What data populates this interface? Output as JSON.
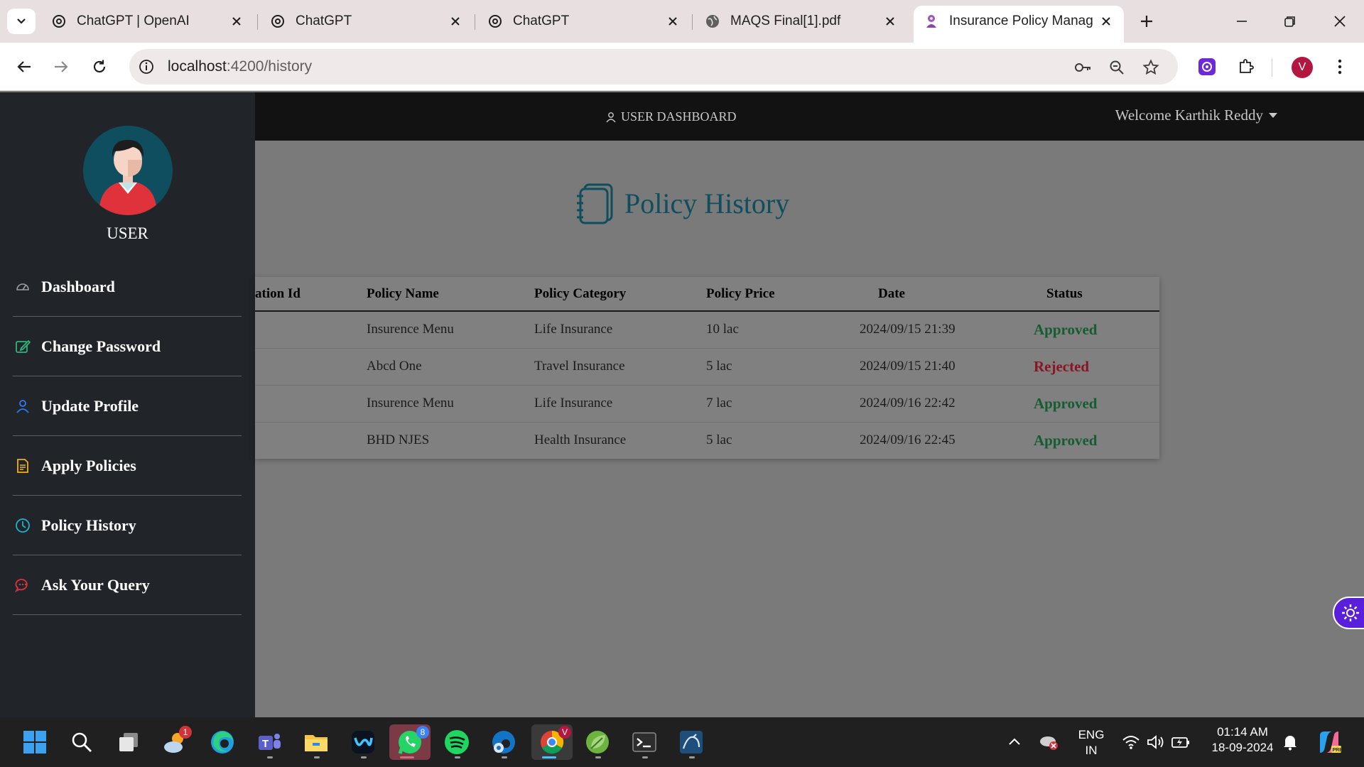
{
  "browser": {
    "tabs": [
      {
        "title": "ChatGPT | OpenAI",
        "icon": "openai-icon"
      },
      {
        "title": "ChatGPT",
        "icon": "openai-icon"
      },
      {
        "title": "ChatGPT",
        "icon": "openai-icon"
      },
      {
        "title": "MAQS Final[1].pdf",
        "icon": "globe-icon"
      },
      {
        "title": "Insurance Policy Managem",
        "icon": "app-icon",
        "active": true
      }
    ],
    "url_host": "localhost",
    "url_path": ":4200/history",
    "profile_initial": "V"
  },
  "topnav": {
    "dashboard_label": "USER DASHBOARD",
    "welcome": "Welcome Karthik Reddy"
  },
  "sidebar": {
    "role": "USER",
    "items": [
      {
        "label": "Dashboard",
        "icon": "speedometer-icon",
        "color": "#9aa0a6"
      },
      {
        "label": "Change Password",
        "icon": "edit-icon",
        "color": "#2eb67d"
      },
      {
        "label": "Update Profile",
        "icon": "person-icon",
        "color": "#2f7df6"
      },
      {
        "label": "Apply Policies",
        "icon": "document-icon",
        "color": "#f2b01e"
      },
      {
        "label": "Policy History",
        "icon": "clock-icon",
        "color": "#1fb3d2"
      },
      {
        "label": "Ask Your Query",
        "icon": "chat-icon",
        "color": "#d9343f"
      }
    ]
  },
  "page": {
    "title": "Policy History"
  },
  "table": {
    "headers": [
      "ation Id",
      "Policy Name",
      "Policy Category",
      "Policy Price",
      "Date",
      "Status"
    ],
    "rows": [
      {
        "id": "",
        "name": "Insurence Menu",
        "category": "Life Insurance",
        "price": "10 lac",
        "date": "2024/09/15 21:39",
        "status": "Approved"
      },
      {
        "id": "",
        "name": "Abcd One",
        "category": "Travel Insurance",
        "price": "5 lac",
        "date": "2024/09/15 21:40",
        "status": "Rejected"
      },
      {
        "id": "",
        "name": "Insurence Menu",
        "category": "Life Insurance",
        "price": "7 lac",
        "date": "2024/09/16 22:42",
        "status": "Approved"
      },
      {
        "id": "",
        "name": "BHD NJES",
        "category": "Health Insurance",
        "price": "5 lac",
        "date": "2024/09/16 22:45",
        "status": "Approved"
      }
    ]
  },
  "taskbar": {
    "apps": [
      {
        "name": "start-button"
      },
      {
        "name": "search"
      },
      {
        "name": "task-view"
      },
      {
        "name": "weather",
        "badge": "1"
      },
      {
        "name": "edge"
      },
      {
        "name": "teams"
      },
      {
        "name": "file-explorer"
      },
      {
        "name": "webex"
      },
      {
        "name": "whatsapp",
        "badge": "8"
      },
      {
        "name": "spotify"
      },
      {
        "name": "edge-beta"
      },
      {
        "name": "chrome",
        "badge": "V"
      },
      {
        "name": "spring-tool"
      },
      {
        "name": "terminal"
      },
      {
        "name": "mysql-workbench"
      }
    ],
    "lang_line1": "ENG",
    "lang_line2": "IN",
    "time": "01:14 AM",
    "date": "18-09-2024"
  }
}
